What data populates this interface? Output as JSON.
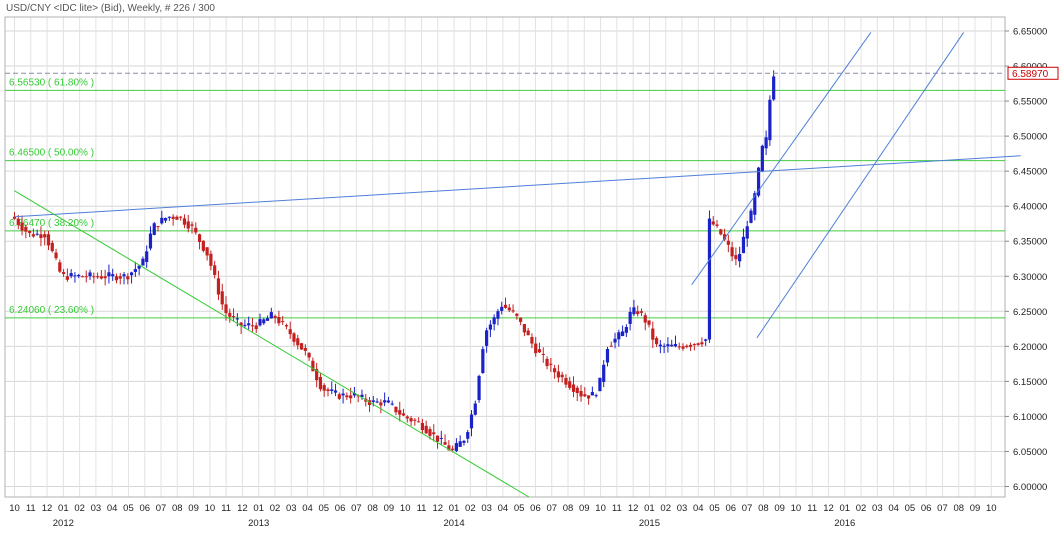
{
  "chart_data": {
    "type": "candlestick",
    "title": "USD/CNY <IDC lite> (Bid), Weekly, # 226 / 300",
    "y_ticks": [
      "6.65000",
      "6.60000",
      "6.55000",
      "6.50000",
      "6.45000",
      "6.40000",
      "6.35000",
      "6.30000",
      "6.25000",
      "6.20000",
      "6.15000",
      "6.10000",
      "6.05000",
      "6.00000"
    ],
    "ylim": [
      5.985,
      6.67
    ],
    "current_price": "6.58970",
    "current_value": 6.5897,
    "month_ticks": [
      "10",
      "11",
      "12",
      "01",
      "02",
      "03",
      "04",
      "05",
      "06",
      "07",
      "08",
      "09",
      "10",
      "11",
      "12",
      "01",
      "02",
      "03",
      "04",
      "05",
      "06",
      "07",
      "08",
      "09",
      "10",
      "11",
      "12",
      "01",
      "02",
      "03",
      "04",
      "05",
      "06",
      "07",
      "08",
      "09",
      "10",
      "11",
      "12",
      "01",
      "02",
      "03",
      "04",
      "05",
      "06",
      "07",
      "08",
      "09",
      "10",
      "11",
      "12",
      "01",
      "02",
      "03",
      "04",
      "05",
      "06",
      "07",
      "08",
      "09",
      "10"
    ],
    "year_ticks": [
      {
        "label": "2012",
        "month_index": 3
      },
      {
        "label": "2013",
        "month_index": 15
      },
      {
        "label": "2014",
        "month_index": 27
      },
      {
        "label": "2015",
        "month_index": 39
      },
      {
        "label": "2016",
        "month_index": 51
      }
    ],
    "fibonacci_levels": [
      {
        "label": "6.56530 ( 61.80% )",
        "value": 6.5653
      },
      {
        "label": "6.46500 ( 50.00% )",
        "value": 6.465
      },
      {
        "label": "6.36470 ( 38.20% )",
        "value": 6.3647
      },
      {
        "label": "6.24060 ( 23.60% )",
        "value": 6.2406
      }
    ],
    "trendlines": [
      {
        "from": [
          0.0,
          6.385
        ],
        "to": [
          61.8,
          6.472
        ],
        "color": "#4f7fd8"
      },
      {
        "from": [
          0.0,
          6.422
        ],
        "to": [
          31.6,
          5.985
        ],
        "color": "#33cc33"
      },
      {
        "from": [
          41.6,
          6.288
        ],
        "to": [
          52.6,
          6.648
        ],
        "color": "#4f7fd8"
      },
      {
        "from": [
          45.6,
          6.212
        ],
        "to": [
          58.3,
          6.648
        ],
        "color": "#4f7fd8"
      }
    ],
    "anchors": [
      [
        0.0,
        6.385
      ],
      [
        1.0,
        6.36
      ],
      [
        2.0,
        6.36
      ],
      [
        3.0,
        6.3
      ],
      [
        4.0,
        6.3
      ],
      [
        5.0,
        6.3
      ],
      [
        6.0,
        6.3
      ],
      [
        7.0,
        6.3
      ],
      [
        8.0,
        6.32
      ],
      [
        8.6,
        6.37
      ],
      [
        9.5,
        6.385
      ],
      [
        10.2,
        6.385
      ],
      [
        11.0,
        6.37
      ],
      [
        12.0,
        6.33
      ],
      [
        13.0,
        6.25
      ],
      [
        14.0,
        6.23
      ],
      [
        15.0,
        6.23
      ],
      [
        16.0,
        6.245
      ],
      [
        17.0,
        6.22
      ],
      [
        18.0,
        6.19
      ],
      [
        19.0,
        6.14
      ],
      [
        20.0,
        6.13
      ],
      [
        21.0,
        6.13
      ],
      [
        22.0,
        6.12
      ],
      [
        23.0,
        6.12
      ],
      [
        24.0,
        6.1
      ],
      [
        25.0,
        6.09
      ],
      [
        26.0,
        6.07
      ],
      [
        27.0,
        6.05
      ],
      [
        27.8,
        6.07
      ],
      [
        28.4,
        6.12
      ],
      [
        29.0,
        6.22
      ],
      [
        29.6,
        6.24
      ],
      [
        30.0,
        6.26
      ],
      [
        30.6,
        6.25
      ],
      [
        31.0,
        6.24
      ],
      [
        32.0,
        6.2
      ],
      [
        33.0,
        6.17
      ],
      [
        34.0,
        6.15
      ],
      [
        35.0,
        6.13
      ],
      [
        35.6,
        6.13
      ],
      [
        36.0,
        6.14
      ],
      [
        36.5,
        6.2
      ],
      [
        37.0,
        6.21
      ],
      [
        37.5,
        6.22
      ],
      [
        38.0,
        6.25
      ],
      [
        38.4,
        6.25
      ],
      [
        38.8,
        6.24
      ],
      [
        39.2,
        6.22
      ],
      [
        39.5,
        6.2
      ],
      [
        40.0,
        6.2
      ],
      [
        41.0,
        6.2
      ],
      [
        42.0,
        6.205
      ],
      [
        42.6,
        6.21
      ],
      [
        42.7,
        6.38
      ],
      [
        43.0,
        6.375
      ],
      [
        43.5,
        6.36
      ],
      [
        44.0,
        6.34
      ],
      [
        44.4,
        6.32
      ],
      [
        44.8,
        6.34
      ],
      [
        45.0,
        6.37
      ],
      [
        45.4,
        6.39
      ],
      [
        45.7,
        6.43
      ],
      [
        46.0,
        6.48
      ],
      [
        46.4,
        6.5
      ],
      [
        46.6,
        6.59
      ],
      [
        46.8,
        6.59
      ]
    ]
  }
}
